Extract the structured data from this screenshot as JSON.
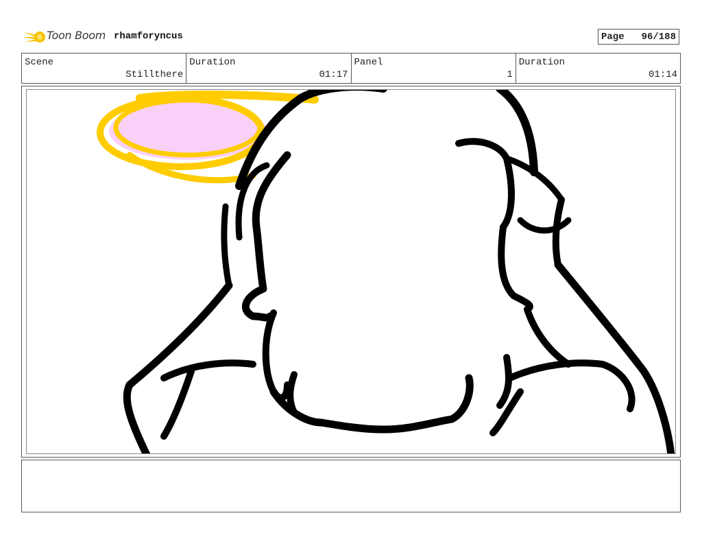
{
  "header": {
    "brand": "Toon Boom",
    "user": "rhamforyncus",
    "page_label": "Page",
    "page_value": "96/188"
  },
  "meta": [
    {
      "label": "Scene",
      "value": "Stillthere"
    },
    {
      "label": "Duration",
      "value": "01:17"
    },
    {
      "label": "Panel",
      "value": "1"
    },
    {
      "label": "Duration",
      "value": "01:14"
    }
  ],
  "colors": {
    "halo_stroke": "#FFCC00",
    "halo_fill": "#F9D0F7",
    "ink": "#000000"
  },
  "notes": ""
}
